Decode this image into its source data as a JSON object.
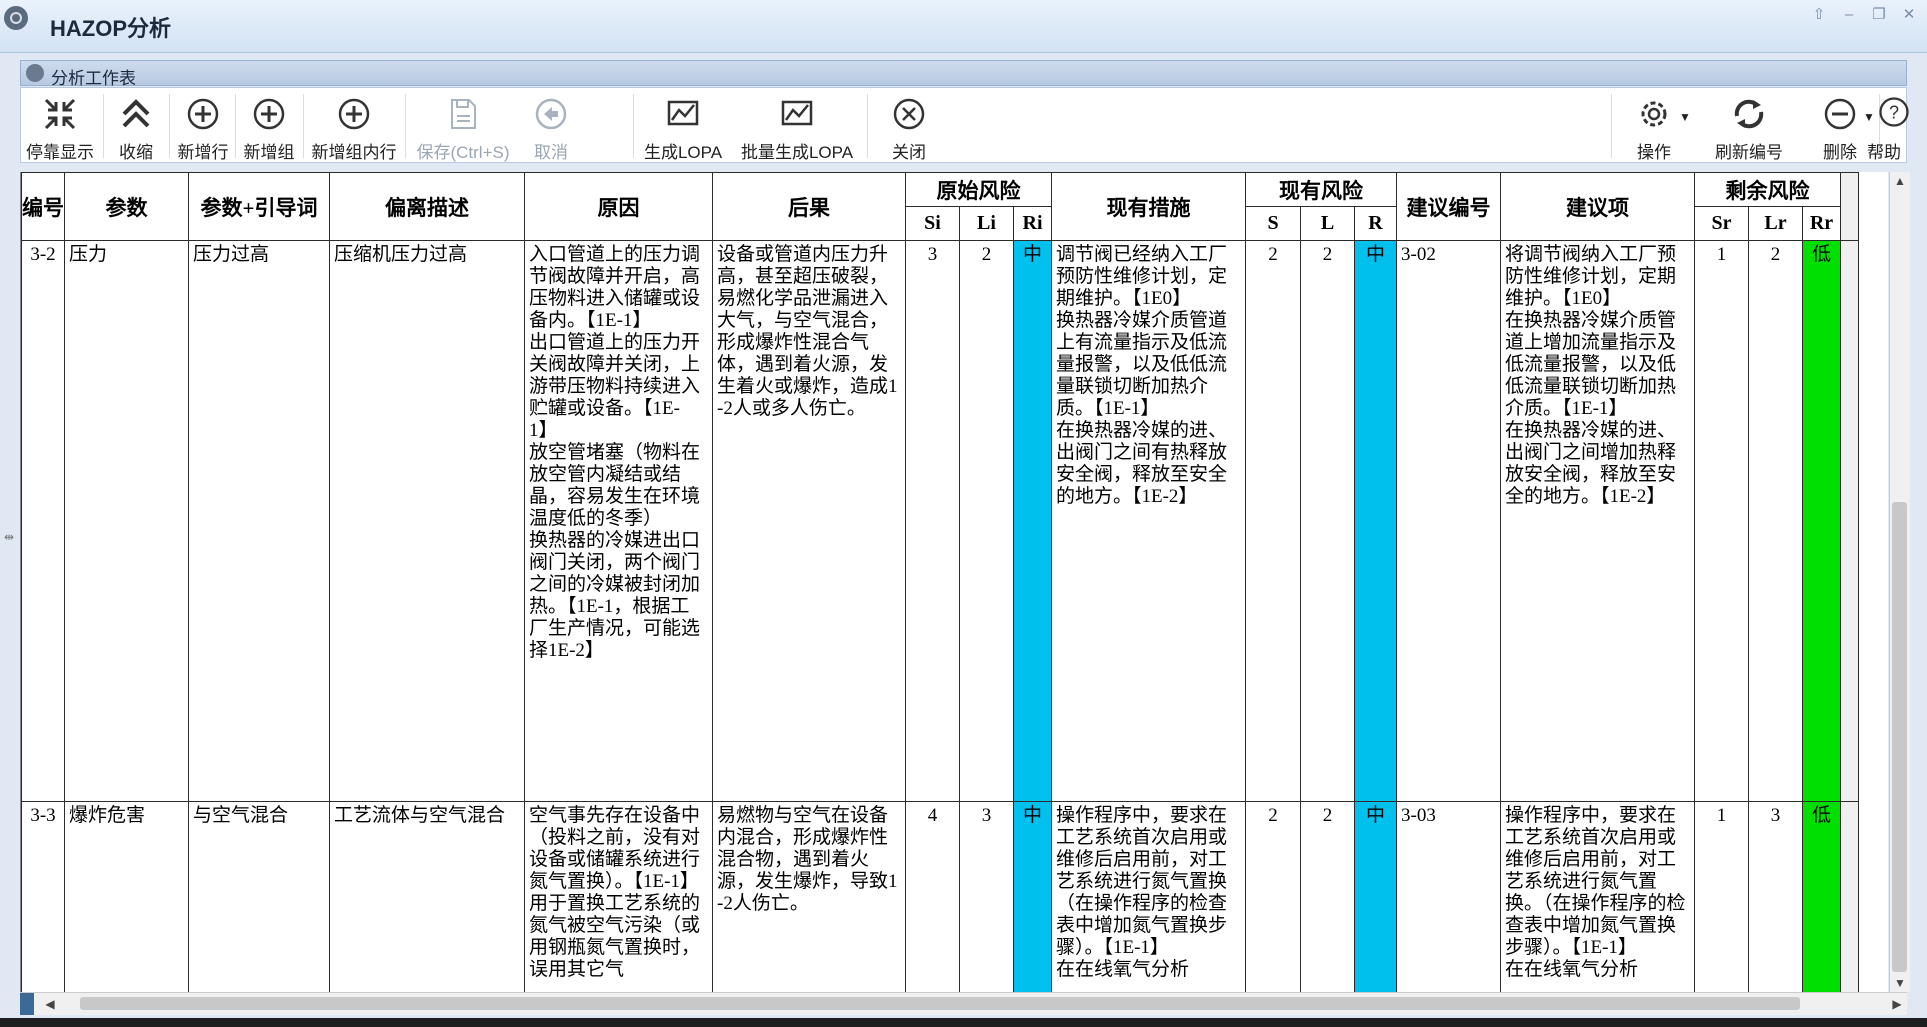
{
  "window": {
    "title": "HAZOP分析",
    "controls": [
      "⇧",
      "–",
      "❐",
      "✕"
    ]
  },
  "panel": {
    "title": "分析工作表"
  },
  "toolbar": {
    "left": [
      {
        "label": "停靠显示",
        "icon": "dock-icon",
        "disabled": false
      },
      {
        "label": "收缩",
        "icon": "collapse-icon",
        "disabled": false
      },
      {
        "label": "新增行",
        "icon": "add-row-icon",
        "disabled": false
      },
      {
        "label": "新增组",
        "icon": "add-group-icon",
        "disabled": false
      },
      {
        "label": "新增组内行",
        "icon": "add-group-row-icon",
        "disabled": false
      },
      {
        "label": "保存(Ctrl+S)",
        "icon": "save-icon",
        "disabled": true
      },
      {
        "label": "取消",
        "icon": "undo-icon",
        "disabled": true
      },
      {
        "label": "生成LOPA",
        "icon": "chart-icon",
        "disabled": false
      },
      {
        "label": "批量生成LOPA",
        "icon": "chart-icon",
        "disabled": false
      },
      {
        "label": "关闭",
        "icon": "close-icon",
        "disabled": false
      }
    ],
    "right": [
      {
        "label": "操作",
        "icon": "gear-icon"
      },
      {
        "label": "刷新编号",
        "icon": "refresh-icon"
      },
      {
        "label": "删除",
        "icon": "minus-circle-icon"
      },
      {
        "label": "帮助",
        "icon": "help-icon"
      }
    ]
  },
  "table": {
    "headers": {
      "id": "编号",
      "param": "参数",
      "guide": "参数+引导词",
      "deviation": "偏离描述",
      "cause": "原因",
      "consequence": "后果",
      "orig_risk": "原始风险",
      "si": "Si",
      "li": "Li",
      "ri": "Ri",
      "measures": "现有措施",
      "curr_risk": "现有风险",
      "s": "S",
      "l": "L",
      "r": "R",
      "rec_no": "建议编号",
      "rec": "建议项",
      "resid_risk": "剩余风险",
      "sr": "Sr",
      "lr": "Lr",
      "rr": "Rr"
    },
    "rows": [
      {
        "id": "3-2",
        "param": "压力",
        "guide": "压力过高",
        "deviation": "压缩机压力过高",
        "cause": "入口管道上的压力调节阀故障并开启，高压物料进入储罐或设备内。【1E-1】\n出口管道上的压力开关阀故障并关闭，上游带压物料持续进入贮罐或设备。【1E-1】\n放空管堵塞（物料在放空管内凝结或结晶，容易发生在环境温度低的冬季）\n换热器的冷媒进出口阀门关闭，两个阀门之间的冷媒被封闭加热。【1E-1，根据工厂生产情况，可能选择1E-2】",
        "consequence": "设备或管道内压力升高，甚至超压破裂，易燃化学品泄漏进入大气，与空气混合，形成爆炸性混合气体，遇到着火源，发生着火或爆炸，造成1-2人或多人伤亡。",
        "si": "3",
        "li": "2",
        "ri": "中",
        "measures": "调节阀已经纳入工厂预防性维修计划，定期维护。【1E0】\n换热器冷媒介质管道上有流量指示及低流量报警，以及低低流量联锁切断加热介质。【1E-1】\n在换热器冷媒的进、出阀门之间有热释放安全阀，释放至安全的地方。【1E-2】",
        "s": "2",
        "l": "2",
        "r": "中",
        "rec_no": "3-02",
        "rec": "将调节阀纳入工厂预防性维修计划，定期维护。【1E0】\n在换热器冷媒介质管道上增加流量指示及低流量报警，以及低低流量联锁切断加热介质。【1E-1】\n在换热器冷媒的进、出阀门之间增加热释放安全阀，释放至安全的地方。【1E-2】",
        "sr": "1",
        "lr": "2",
        "rr": "低"
      },
      {
        "id": "3-3",
        "param": "爆炸危害",
        "guide": "与空气混合",
        "deviation": "工艺流体与空气混合",
        "cause": "空气事先存在设备中（投料之前，没有对设备或储罐系统进行氮气置换）。【1E-1】\n用于置换工艺系统的氮气被空气污染（或用钢瓶氮气置换时，误用其它气",
        "consequence": "易燃物与空气在设备内混合，形成爆炸性混合物，遇到着火源，发生爆炸，导致1-2人伤亡。",
        "si": "4",
        "li": "3",
        "ri": "中",
        "measures": "操作程序中，要求在工艺系统首次启用或维修后启用前，对工艺系统进行氮气置换（在操作程序的检查表中增加氮气置换步骤）。【1E-1】\n在在线氧气分析",
        "s": "2",
        "l": "2",
        "r": "中",
        "rec_no": "3-03",
        "rec": "操作程序中，要求在工艺系统首次启用或维修后启用前，对工艺系统进行氮气置换。（在操作程序的检查表中增加氮气置换步骤）。【1E-1】\n在在线氧气分析",
        "sr": "1",
        "lr": "3",
        "rr": "低"
      }
    ]
  },
  "colors": {
    "risk_mid": "#00c0ee",
    "risk_low": "#00e000"
  }
}
